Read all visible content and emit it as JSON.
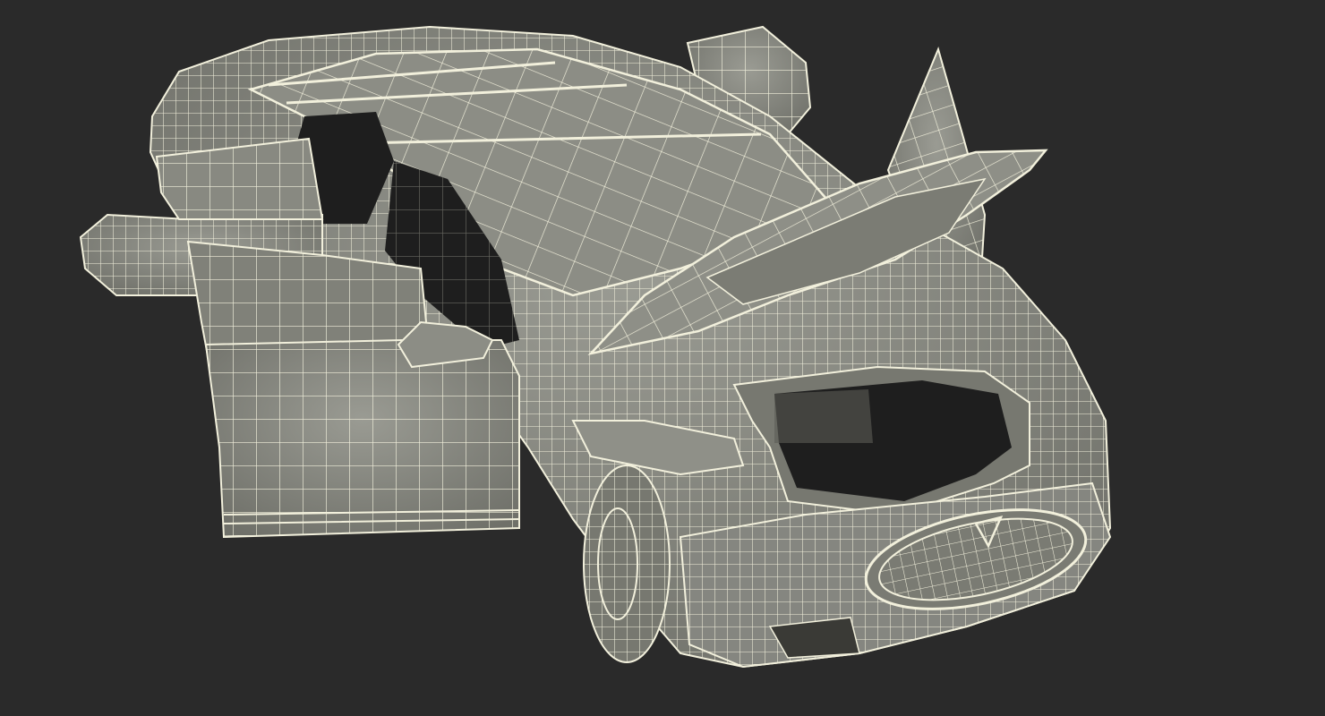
{
  "scene": {
    "subject": "car-wireframe-model",
    "background_color": "#2a2a2a",
    "mesh_fill_color": "#86877f",
    "mesh_fill_dark": "#6f7069",
    "mesh_fill_light": "#9a9b93",
    "wire_color": "#f2f0dc",
    "interior_color": "#1e1e1e",
    "parts": [
      "body",
      "roof",
      "hood-open",
      "front-door-open",
      "rear-door-open",
      "falcon-wing-doors",
      "front-trunk",
      "front-wheel",
      "grille",
      "headlight"
    ]
  }
}
